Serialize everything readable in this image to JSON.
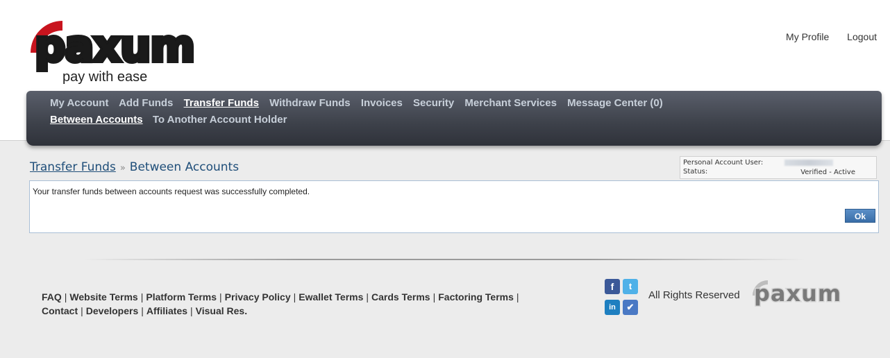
{
  "brand": {
    "name": "paxum",
    "tagline": "pay with ease",
    "accent_color": "#c8141e"
  },
  "top_links": {
    "my_profile": "My Profile",
    "logout": "Logout"
  },
  "nav": {
    "primary": [
      {
        "label": "My Account",
        "active": false
      },
      {
        "label": "Add Funds",
        "active": false
      },
      {
        "label": "Transfer Funds",
        "active": true
      },
      {
        "label": "Withdraw Funds",
        "active": false
      },
      {
        "label": "Invoices",
        "active": false
      },
      {
        "label": "Security",
        "active": false
      },
      {
        "label": "Merchant Services",
        "active": false
      },
      {
        "label": "Message Center (0)",
        "active": false
      }
    ],
    "secondary": [
      {
        "label": "Between Accounts",
        "active": true
      },
      {
        "label": "To Another Account Holder",
        "active": false
      }
    ]
  },
  "breadcrumb": {
    "parent": "Transfer Funds",
    "separator": "»",
    "current": "Between Accounts"
  },
  "account": {
    "user_label": "Personal Account User:",
    "status_label": "Status:",
    "status_value": "Verified - Active"
  },
  "message": {
    "text": "Your transfer funds between accounts request was successfully completed.",
    "ok_label": "Ok"
  },
  "footer": {
    "row1": [
      "FAQ",
      "Website Terms",
      "Platform Terms",
      "Privacy Policy",
      "Ewallet Terms",
      "Cards Terms",
      "Factoring Terms"
    ],
    "row2": [
      "Contact",
      "Developers",
      "Affiliates",
      "Visual Res."
    ],
    "social_icons": [
      "facebook-icon",
      "twitter-icon",
      "linkedin-icon",
      "checkmark-icon"
    ],
    "rights": "All Rights Reserved"
  }
}
